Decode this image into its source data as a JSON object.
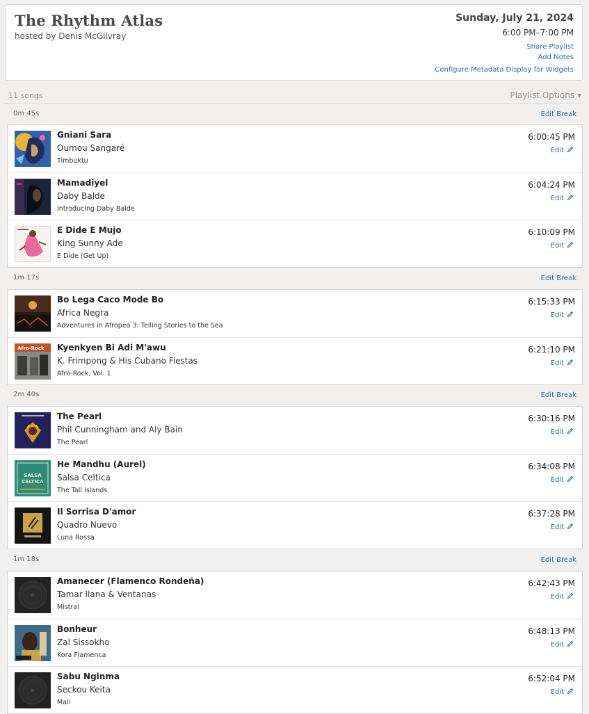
{
  "header": {
    "title": "The Rhythm Atlas",
    "host": "hosted by Denis McGilvray",
    "date": "Sunday, July 21, 2024",
    "time_range": "6:00 PM–7:00 PM",
    "share_label": "Share Playlist",
    "notes_label": "Add Notes",
    "config_label": "Configure Metadata Display for Widgets"
  },
  "summary": {
    "song_count": "11 songs",
    "options_label": "Playlist Options ▾"
  },
  "edit_label": "Edit",
  "edit_break_label": "Edit Break",
  "breaks": [
    {
      "duration": "0m 45s"
    },
    {
      "duration": "1m 17s"
    },
    {
      "duration": "2m 40s"
    },
    {
      "duration": "1m 18s"
    }
  ],
  "groups": [
    {
      "songs": [
        {
          "title": "Gniani Sara",
          "artist": "Oumou Sangaré",
          "album": "Timbuktu",
          "time": "6:00:45 PM",
          "art": "art-gniani"
        },
        {
          "title": "Mamadiyel",
          "artist": "Daby Balde",
          "album": "Introducing Daby Balde",
          "time": "6:04:24 PM",
          "art": "art-mamadiyel"
        },
        {
          "title": "E Dide E Mujo",
          "artist": "King Sunny Ade",
          "album": "E Dide (Get Up)",
          "time": "6:10:09 PM",
          "art": "art-edide"
        }
      ]
    },
    {
      "songs": [
        {
          "title": "Bo Lega Caco Mode Bo",
          "artist": "Africa Negra",
          "album": "Adventures in Afropea 3: Telling Stories to the Sea",
          "time": "6:15:33 PM",
          "art": "art-bolega"
        },
        {
          "title": "Kyenkyen Bi Adi M'awu",
          "artist": "K. Frimpong & His Cubano Fiestas",
          "album": "Afro-Rock, Vol. 1",
          "time": "6:21:10 PM",
          "art": "art-afrorock"
        }
      ]
    },
    {
      "songs": [
        {
          "title": "The Pearl",
          "artist": "Phil Cunningham and Aly Bain",
          "album": "The Pearl",
          "time": "6:30:16 PM",
          "art": "art-pearl"
        },
        {
          "title": "He Mandhu (Aurel)",
          "artist": "Salsa Celtica",
          "album": "The Tall Islands",
          "time": "6:34:08 PM",
          "art": "art-salsa"
        },
        {
          "title": "Il Sorrisa D'amor",
          "artist": "Quadro Nuevo",
          "album": "Luna Rossa",
          "time": "6:37:28 PM",
          "art": "art-luna"
        }
      ]
    },
    {
      "songs": [
        {
          "title": "Amanecer (Flamenco Rondeña)",
          "artist": "Tamar Ilana & Ventanas",
          "album": "Mistral",
          "time": "6:42:43 PM",
          "art": "art-placeholder"
        },
        {
          "title": "Bonheur",
          "artist": "Zal Sissokho",
          "album": "Kora Flamenca",
          "time": "6:48:13 PM",
          "art": "art-bonheur"
        },
        {
          "title": "Sabu Nginma",
          "artist": "Seckou Keita",
          "album": "Mali",
          "time": "6:52:04 PM",
          "art": "art-placeholder"
        }
      ]
    }
  ],
  "art_labels": {
    "afrorock": "Afro-Rock",
    "salsa": "SALSA CELTICA"
  },
  "colors": {
    "link": "#2a6db5",
    "background": "#f1f0ef"
  }
}
